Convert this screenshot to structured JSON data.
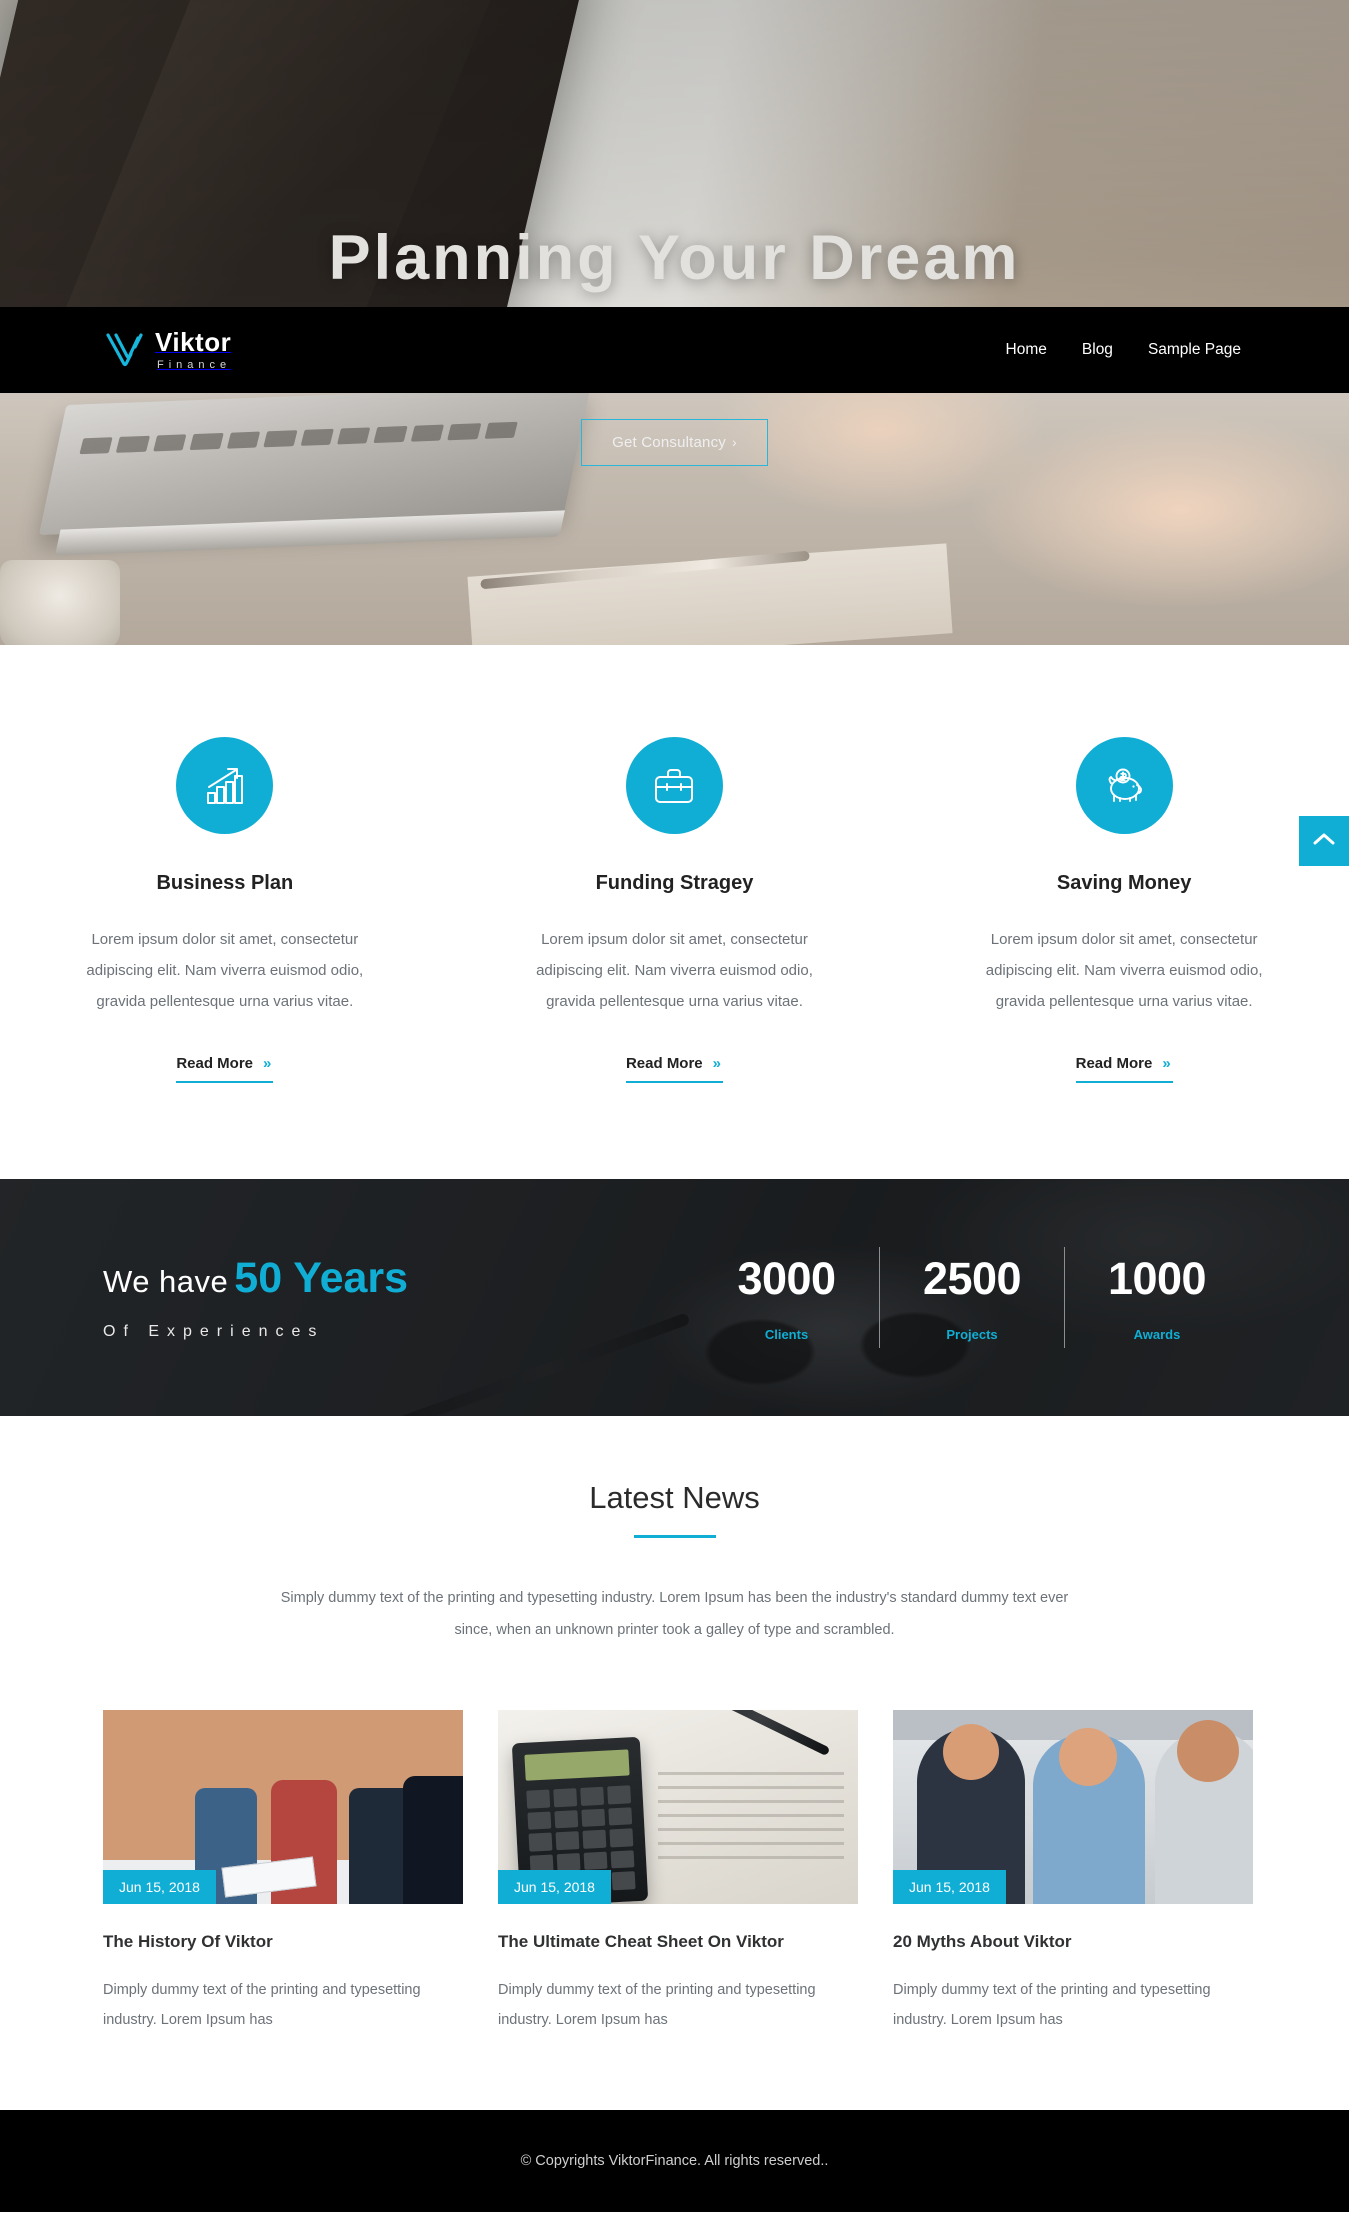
{
  "hero": {
    "title": "Planning Your Dream",
    "cta_label": "Get Consultancy",
    "cta_chevron": "›"
  },
  "navbar": {
    "brand_name": "Viktor",
    "brand_sub": "Finance",
    "logo_icon": "v-monogram-icon",
    "menu": [
      {
        "label": "Home"
      },
      {
        "label": "Blog"
      },
      {
        "label": "Sample Page"
      }
    ]
  },
  "services": {
    "items": [
      {
        "icon": "bar-chart-growth-icon",
        "title": "Business Plan",
        "desc": "Lorem ipsum dolor sit amet, consectetur adipiscing elit. Nam viverra euismod odio, gravida pellentesque urna varius vitae.",
        "more_label": "Read More",
        "more_chevron": "»"
      },
      {
        "icon": "briefcase-icon",
        "title": "Funding Stragey",
        "desc": "Lorem ipsum dolor sit amet, consectetur adipiscing elit. Nam viverra euismod odio, gravida pellentesque urna varius vitae.",
        "more_label": "Read More",
        "more_chevron": "»"
      },
      {
        "icon": "piggy-bank-icon",
        "title": "Saving Money",
        "desc": "Lorem ipsum dolor sit amet, consectetur adipiscing elit. Nam viverra euismod odio, gravida pellentesque urna varius vitae.",
        "more_label": "Read More",
        "more_chevron": "»"
      }
    ]
  },
  "scroll_top": {
    "icon": "chevron-up-icon"
  },
  "stats": {
    "headline_prefix": "We have",
    "headline_highlight": "50 Years",
    "subline": "Of Experiences",
    "counters": [
      {
        "value": "3000",
        "label": "Clients"
      },
      {
        "value": "2500",
        "label": "Projects"
      },
      {
        "value": "1000",
        "label": "Awards"
      }
    ]
  },
  "news": {
    "title": "Latest News",
    "lead": "Simply dummy text of the printing and typesetting industry. Lorem Ipsum has been the industry's standard dummy text ever since, when an unknown printer took a galley of type and scrambled.",
    "cards": [
      {
        "date": "Jun 15, 2018",
        "title": "The History Of Viktor",
        "text": "Dimply dummy text of the printing and typesetting industry. Lorem Ipsum has"
      },
      {
        "date": "Jun 15, 2018",
        "title": "The Ultimate Cheat Sheet On Viktor",
        "text": "Dimply dummy text of the printing and typesetting industry. Lorem Ipsum has"
      },
      {
        "date": "Jun 15, 2018",
        "title": "20 Myths About Viktor",
        "text": "Dimply dummy text of the printing and typesetting industry. Lorem Ipsum has"
      }
    ]
  },
  "footer": {
    "copyright": "© Copyrights ViktorFinance. All rights reserved.."
  },
  "colors": {
    "accent": "#10aed4",
    "dark": "#000000",
    "body_text": "#6c7278"
  }
}
